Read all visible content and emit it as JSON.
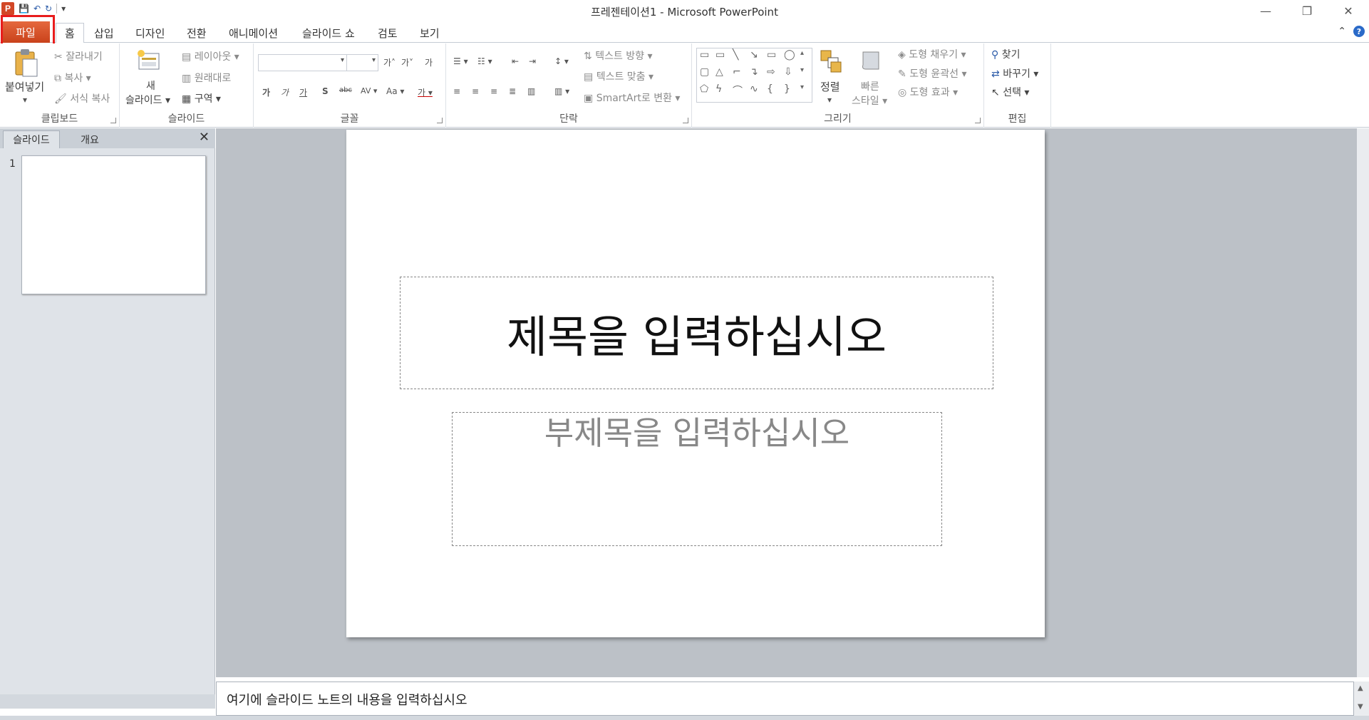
{
  "window": {
    "title": "프레젠테이션1 - Microsoft PowerPoint",
    "controls": [
      "—",
      "❐",
      "✕"
    ]
  },
  "qat": {
    "app_icon": "P",
    "save": "💾",
    "undo": "↶",
    "redo": "↻",
    "customize": "▾"
  },
  "tabs": [
    "파일",
    "홈",
    "삽입",
    "디자인",
    "전환",
    "애니메이션",
    "슬라이드 쇼",
    "검토",
    "보기"
  ],
  "tab_right": {
    "minimize_ribbon": "⌃",
    "help": "?"
  },
  "ribbon": {
    "clipboard": {
      "label": "클립보드",
      "paste": "붙여넣기",
      "cut": "잘라내기",
      "copy": "복사",
      "format_painter": "서식 복사"
    },
    "slides": {
      "label": "슬라이드",
      "new_slide_line1": "새",
      "new_slide_line2": "슬라이드",
      "layout": "레이아웃",
      "reset": "원래대로",
      "section": "구역"
    },
    "font": {
      "label": "글꼴",
      "grow": "가",
      "shrink": "가",
      "clear": "가",
      "bold": "가",
      "italic": "가",
      "underline": "가",
      "shadow": "S",
      "strike": "abc",
      "spacing": "AV",
      "case": "Aa",
      "color": "가"
    },
    "paragraph": {
      "label": "단락",
      "text_direction": "텍스트 방향",
      "align_text": "텍스트 맞춤",
      "smartart": "SmartArt로 변환"
    },
    "drawing": {
      "label": "그리기",
      "arrange": "정렬",
      "quick_styles_1": "빠른",
      "quick_styles_2": "스타일",
      "shape_fill": "도형 채우기",
      "shape_outline": "도형 윤곽선",
      "shape_effects": "도형 효과"
    },
    "editing": {
      "label": "편집",
      "find": "찾기",
      "replace": "바꾸기",
      "select": "선택"
    }
  },
  "left_pane": {
    "tab_slides": "슬라이드",
    "tab_outline": "개요",
    "close": "✕",
    "slide_number": "1"
  },
  "slide": {
    "title_placeholder": "제목을 입력하십시오",
    "subtitle_placeholder": "부제목을 입력하십시오"
  },
  "notes": {
    "placeholder": "여기에 슬라이드 노트의 내용을 입력하십시오"
  }
}
